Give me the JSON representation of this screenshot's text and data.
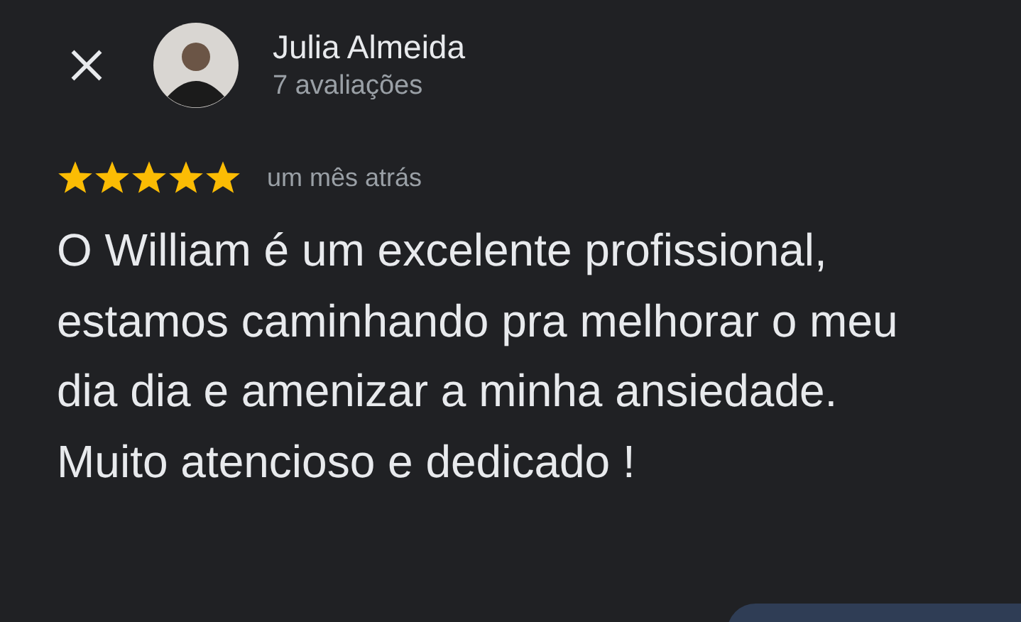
{
  "reviewer": {
    "name": "Julia Almeida",
    "reviews_count": "7 avaliações"
  },
  "review": {
    "stars": 5,
    "time": "um mês atrás",
    "text": "O William é um excelente profissional, estamos caminhando pra melhorar o meu dia dia e amenizar a minha ansiedade. Muito atencioso e dedicado !"
  }
}
